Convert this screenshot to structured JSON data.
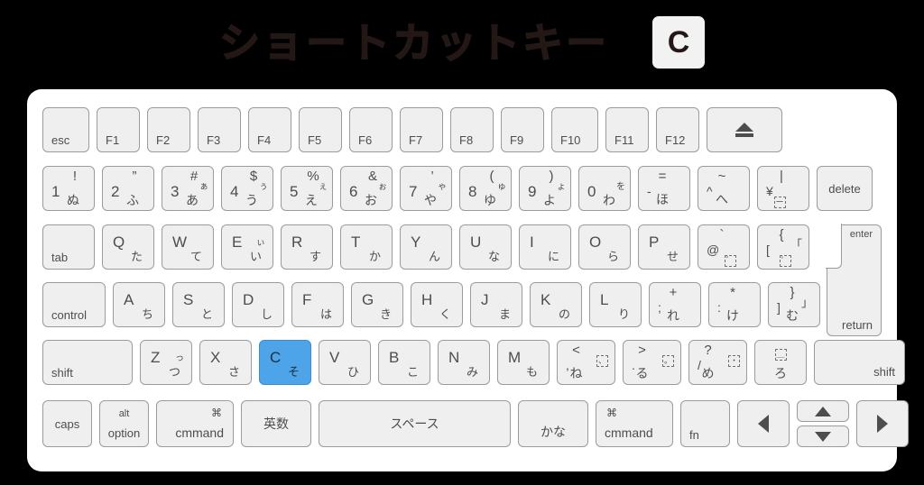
{
  "title": {
    "text": "ショートカットキー",
    "badge_key": "C"
  },
  "colors": {
    "background": "#000000",
    "keyboard_body": "#ffffff",
    "key_face": "#efefef",
    "key_border": "#9b9b9b",
    "key_text": "#4d4d4d",
    "highlight": "#4ea4e8",
    "title_text": "#231815"
  },
  "highlighted_key": "C",
  "rows": {
    "function_row": [
      {
        "label": "esc"
      },
      {
        "label": "F1"
      },
      {
        "label": "F2"
      },
      {
        "label": "F3"
      },
      {
        "label": "F4"
      },
      {
        "label": "F5"
      },
      {
        "label": "F6"
      },
      {
        "label": "F7"
      },
      {
        "label": "F8"
      },
      {
        "label": "F9"
      },
      {
        "label": "F10"
      },
      {
        "label": "F11"
      },
      {
        "label": "F12"
      },
      {
        "label": "eject-icon"
      }
    ],
    "number_row": [
      {
        "num": "1",
        "sym": "!",
        "kana": "ぬ",
        "kana_small": ""
      },
      {
        "num": "2",
        "sym": "”",
        "kana": "ふ",
        "kana_small": ""
      },
      {
        "num": "3",
        "sym": "#",
        "kana": "あ",
        "kana_small": "ぁ"
      },
      {
        "num": "4",
        "sym": "$",
        "kana": "う",
        "kana_small": "ぅ"
      },
      {
        "num": "5",
        "sym": "%",
        "kana": "え",
        "kana_small": "ぇ"
      },
      {
        "num": "6",
        "sym": "&",
        "kana": "お",
        "kana_small": "ぉ"
      },
      {
        "num": "7",
        "sym": "’",
        "kana": "や",
        "kana_small": "ゃ"
      },
      {
        "num": "8",
        "sym": "(",
        "kana": "ゆ",
        "kana_small": "ゅ"
      },
      {
        "num": "9",
        "sym": ")",
        "kana": "よ",
        "kana_small": "ょ"
      },
      {
        "num": "0",
        "sym": "",
        "kana": "わ",
        "kana_small": "を"
      }
    ],
    "number_row_symbols": [
      {
        "lower": "-",
        "upper": "=",
        "kana": "ほ"
      },
      {
        "lower": "^",
        "upper": "~",
        "kana": "へ"
      },
      {
        "lower": "¥",
        "upper": "|",
        "kana": "dotted-box-icon"
      }
    ],
    "number_row_end": {
      "label": "delete"
    },
    "qwerty_row": {
      "tab": "tab",
      "keys": [
        {
          "latin": "Q",
          "kana": "た",
          "kana_small": ""
        },
        {
          "latin": "W",
          "kana": "て",
          "kana_small": ""
        },
        {
          "latin": "E",
          "kana": "い",
          "kana_small": "ぃ"
        },
        {
          "latin": "R",
          "kana": "す",
          "kana_small": ""
        },
        {
          "latin": "T",
          "kana": "か",
          "kana_small": ""
        },
        {
          "latin": "Y",
          "kana": "ん",
          "kana_small": ""
        },
        {
          "latin": "U",
          "kana": "な",
          "kana_small": ""
        },
        {
          "latin": "I",
          "kana": "に",
          "kana_small": ""
        },
        {
          "latin": "O",
          "kana": "ら",
          "kana_small": ""
        },
        {
          "latin": "P",
          "kana": "せ",
          "kana_small": ""
        }
      ],
      "at_key": {
        "lower": "@",
        "upper": "`",
        "kana": "dakuten-box-icon"
      },
      "bracket_key": {
        "lower": "[",
        "upper": "{",
        "kana": "handakuten-box-icon",
        "kana2": "「"
      },
      "return_key": {
        "top": "enter",
        "bottom": "return"
      }
    },
    "asdf_row": {
      "control": "control",
      "keys": [
        {
          "latin": "A",
          "kana": "ち"
        },
        {
          "latin": "S",
          "kana": "と"
        },
        {
          "latin": "D",
          "kana": "し"
        },
        {
          "latin": "F",
          "kana": "は"
        },
        {
          "latin": "G",
          "kana": "き"
        },
        {
          "latin": "H",
          "kana": "く"
        },
        {
          "latin": "J",
          "kana": "ま"
        },
        {
          "latin": "K",
          "kana": "の"
        },
        {
          "latin": "L",
          "kana": "り"
        }
      ],
      "semicolon_key": {
        "lower": ";",
        "upper": "+",
        "kana": "れ"
      },
      "quote_key": {
        "lower": ":",
        "upper": "*",
        "kana": "け"
      },
      "rbracket_key": {
        "lower": "]",
        "upper": "}",
        "kana": "む",
        "kana2": "」"
      }
    },
    "zxcv_row": {
      "shift_left": "shift",
      "keys": [
        {
          "latin": "Z",
          "kana": "つ",
          "kana_small": "っ"
        },
        {
          "latin": "X",
          "kana": "さ",
          "kana_small": ""
        },
        {
          "latin": "C",
          "kana": "そ",
          "kana_small": "",
          "highlighted": true
        },
        {
          "latin": "V",
          "kana": "ひ",
          "kana_small": ""
        },
        {
          "latin": "B",
          "kana": "こ",
          "kana_small": ""
        },
        {
          "latin": "N",
          "kana": "み",
          "kana_small": ""
        },
        {
          "latin": "M",
          "kana": "も",
          "kana_small": ""
        }
      ],
      "comma_key": {
        "lower": ",",
        "upper": "<",
        "kana": "ね",
        "kana2": "、"
      },
      "period_key": {
        "lower": ".",
        "upper": ">",
        "kana": "る",
        "kana2": "。"
      },
      "slash_key": {
        "lower": "/",
        "upper": "?",
        "kana": "め",
        "kana2": "・"
      },
      "underscore_key": {
        "upper": "dotted-box-icon",
        "kana": "ろ"
      },
      "shift_right": "shift"
    },
    "bottom_row": {
      "caps": "caps",
      "option": {
        "top": "alt",
        "bottom": "option"
      },
      "command_left": {
        "top": "⌘",
        "bottom": "cmmand"
      },
      "eisu": "英数",
      "space": "スペース",
      "kana": "かな",
      "command_right": {
        "top": "⌘",
        "bottom": "cmmand"
      },
      "fn": "fn",
      "arrow_left": "arrow-left-icon",
      "arrow_up": "arrow-up-icon",
      "arrow_down": "arrow-down-icon",
      "arrow_right": "arrow-right-icon"
    }
  }
}
